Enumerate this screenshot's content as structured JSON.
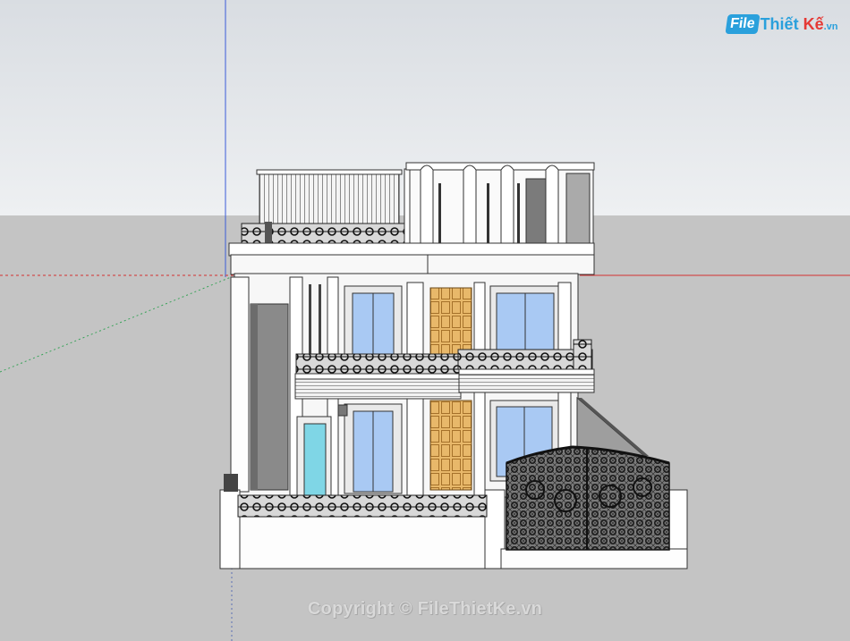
{
  "logo": {
    "badge": "File",
    "name": "Thiết",
    "ke": "Kế",
    "suffix": ".vn"
  },
  "watermark": "Copyright © FileThietKe.vn",
  "colors": {
    "sky": "#e6e9ed",
    "ground": "#c4c4c4",
    "wall": "#f7f7f7",
    "window_glass": "#a9c9f3",
    "door_wood": "#e8b86a",
    "railing": "#2a2a2a",
    "axis_red": "#d32f2f",
    "axis_blue": "#3a5bd9",
    "axis_green": "#3aa35a"
  }
}
